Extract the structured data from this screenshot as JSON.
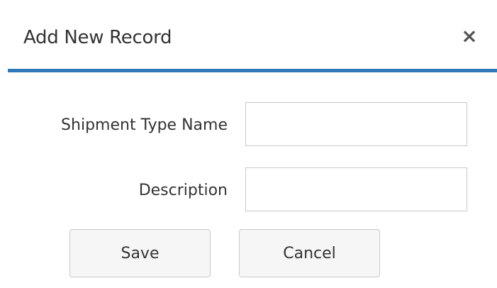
{
  "dialog": {
    "title": "Add New Record",
    "close_glyph": "×",
    "close_icon": "close-icon"
  },
  "form": {
    "shipment_type_name": {
      "label": "Shipment Type Name",
      "value": "",
      "placeholder": ""
    },
    "description": {
      "label": "Description",
      "value": "",
      "placeholder": ""
    }
  },
  "actions": {
    "save_label": "Save",
    "cancel_label": "Cancel"
  },
  "colors": {
    "accent": "#3178b9",
    "text": "#333333",
    "border": "#c8c8c8",
    "button_bg": "#f6f6f6"
  }
}
